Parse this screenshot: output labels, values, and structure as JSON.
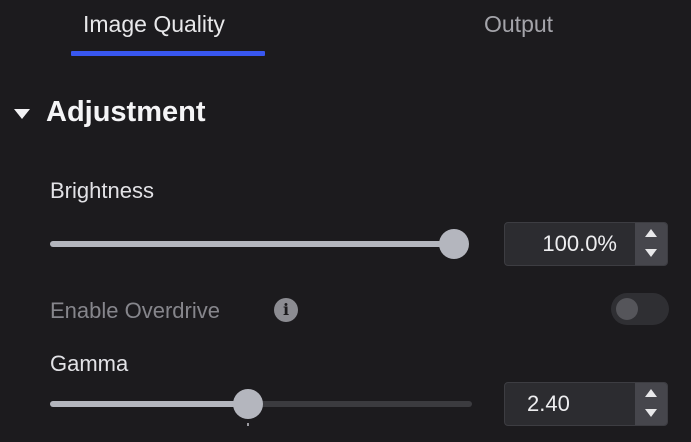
{
  "colors": {
    "accent": "#3857f0",
    "background": "#1c1b1e",
    "slider_fill": "#b4b6be",
    "disabled_text": "#86868c"
  },
  "tabs": [
    {
      "label": "Image Quality",
      "active": true
    },
    {
      "label": "Output",
      "active": false
    }
  ],
  "section": {
    "title": "Adjustment",
    "expanded": true,
    "caret_icon": "caret-down-icon"
  },
  "brightness": {
    "label": "Brightness",
    "value_text": "100.0%",
    "fraction": 1.0
  },
  "overdrive": {
    "label": "Enable Overdrive",
    "info_icon": "info-icon",
    "info_glyph": "i",
    "enabled": false
  },
  "gamma": {
    "label": "Gamma",
    "value_text": "2.40",
    "fraction": 0.47,
    "default_fraction": 0.47
  }
}
